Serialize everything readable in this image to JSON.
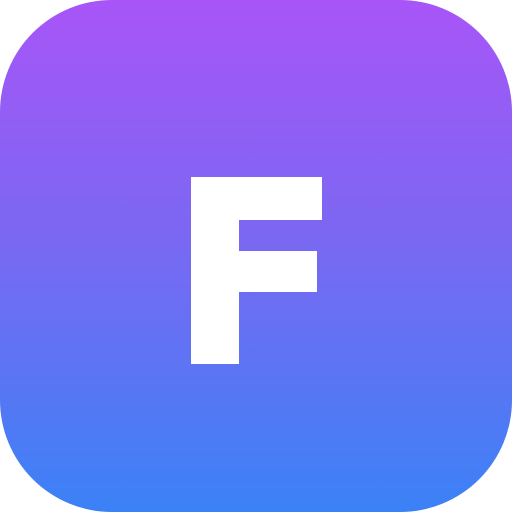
{
  "app_icon": {
    "letter": "F",
    "gradient_top_color": "#a855f7",
    "gradient_bottom_color": "#3b82f6",
    "letter_color": "#ffffff"
  }
}
